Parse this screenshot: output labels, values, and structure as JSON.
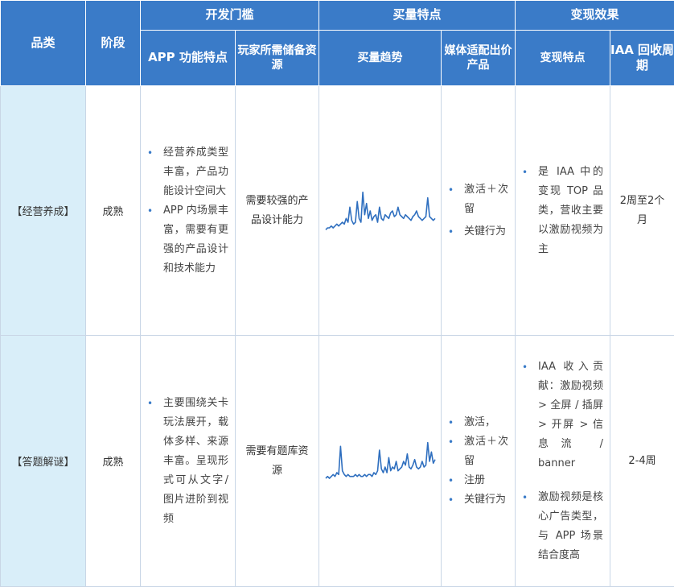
{
  "header": {
    "category": "品类",
    "stage": "阶段",
    "dev_threshold": "开发门槛",
    "app_features": "APP 功能特点",
    "player_resources": "玩家所需储备资源",
    "acquisition": "买量特点",
    "acquisition_trend": "买量趋势",
    "media_bidding": "媒体适配出价产品",
    "monetization": "变现效果",
    "monetization_features": "变现特点",
    "iaa_payback": "IAA 回收周期"
  },
  "rows": [
    {
      "category": "【经营养成】",
      "stage": "成熟",
      "features": [
        "经营养成类型丰富，产品功能设计空间大",
        "APP 内场景丰富，需要有更强的产品设计和技术能力"
      ],
      "resources": "需要较强的产品设计能力",
      "bidding": [
        "激活＋次留",
        "关键行为"
      ],
      "monetization": [
        "是 IAA 中的变现 TOP 品类，营收主要以激励视频为主"
      ],
      "payback": "2周至2个月"
    },
    {
      "category": "【答题解谜】",
      "stage": "成熟",
      "features": [
        "主要围绕关卡玩法展开，载体多样、来源丰富。呈现形式可从文字/图片进阶到视频"
      ],
      "resources": "需要有题库资源",
      "bidding": [
        "激活，",
        "激活＋次留",
        "注册",
        "关键行为"
      ],
      "monetization": [
        "IAA 收入贡献：激励视频 > 全屏 / 插屏 > 开屏 > 信息流 / banner",
        "激励视频是核心广告类型，与 APP 场景结合度高"
      ],
      "payback": "2-4周"
    }
  ],
  "chart_data": [
    {
      "type": "line",
      "x": [
        0,
        1,
        2,
        3,
        4,
        5,
        6,
        7,
        8,
        9,
        10,
        11,
        12,
        13,
        14,
        15,
        16,
        17,
        18,
        19,
        20,
        21,
        22,
        23,
        24,
        25,
        26,
        27,
        28,
        29,
        30,
        31,
        32,
        33,
        34,
        35,
        36,
        37,
        38,
        39,
        40,
        41,
        42,
        43,
        44,
        45,
        46,
        47,
        48,
        49,
        50,
        51,
        52,
        53,
        54,
        55,
        56,
        57,
        58,
        59
      ],
      "y": [
        2,
        3,
        3,
        4,
        3,
        4,
        5,
        4,
        5,
        6,
        5,
        8,
        6,
        14,
        7,
        5,
        6,
        17,
        8,
        6,
        22,
        10,
        16,
        8,
        12,
        7,
        9,
        10,
        6,
        14,
        8,
        7,
        10,
        9,
        8,
        11,
        12,
        9,
        10,
        14,
        10,
        9,
        8,
        10,
        9,
        8,
        7,
        9,
        10,
        12,
        9,
        8,
        7,
        8,
        9,
        19,
        9,
        8,
        7,
        8
      ],
      "color": "#2f6fbf"
    },
    {
      "type": "line",
      "x": [
        0,
        1,
        2,
        3,
        4,
        5,
        6,
        7,
        8,
        9,
        10,
        11,
        12,
        13,
        14,
        15,
        16,
        17,
        18,
        19,
        20,
        21,
        22,
        23,
        24,
        25,
        26,
        27,
        28,
        29,
        30,
        31,
        32,
        33,
        34,
        35,
        36,
        37,
        38,
        39,
        40,
        41,
        42,
        43,
        44,
        45,
        46,
        47,
        48,
        49,
        50,
        51,
        52,
        53,
        54,
        55,
        56,
        57,
        58,
        59
      ],
      "y": [
        3,
        4,
        3,
        4,
        5,
        4,
        6,
        5,
        20,
        7,
        5,
        4,
        5,
        4,
        4,
        4,
        5,
        4,
        5,
        4,
        4,
        5,
        4,
        5,
        5,
        4,
        6,
        5,
        7,
        18,
        8,
        6,
        9,
        6,
        14,
        7,
        9,
        8,
        12,
        7,
        8,
        9,
        12,
        10,
        16,
        9,
        8,
        10,
        13,
        9,
        8,
        9,
        12,
        9,
        10,
        22,
        12,
        17,
        11,
        13
      ],
      "color": "#2f6fbf"
    }
  ]
}
